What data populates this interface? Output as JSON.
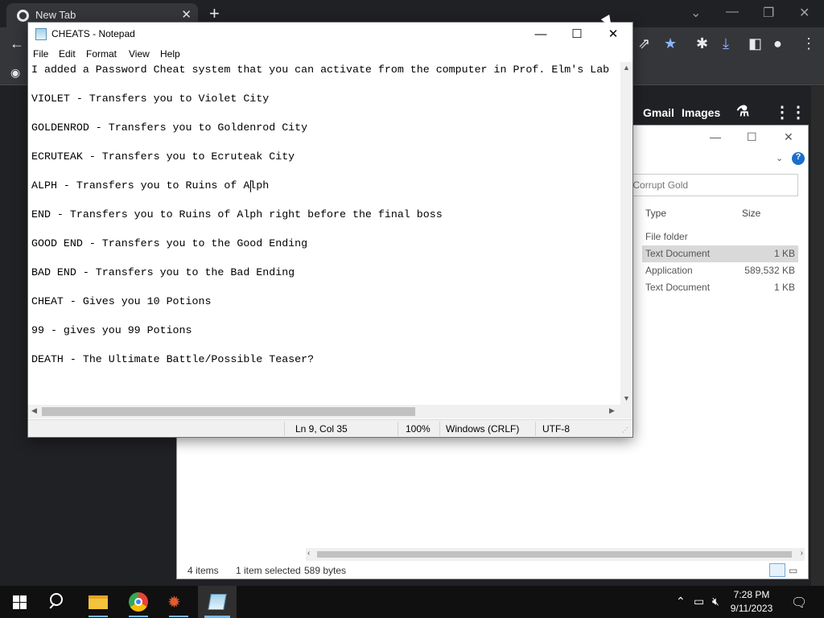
{
  "browser": {
    "tab_title": "New Tab",
    "google_links": {
      "gmail": "Gmail",
      "images": "Images"
    }
  },
  "explorer": {
    "search_placeholder": "Search Corrupt Gold",
    "columns": {
      "type": "Type",
      "size": "Size"
    },
    "rows": [
      {
        "type": "File folder",
        "size": ""
      },
      {
        "type": "Text Document",
        "size": "1 KB",
        "selected": true
      },
      {
        "type": "Application",
        "size": "589,532 KB"
      },
      {
        "type": "Text Document",
        "size": "1 KB"
      }
    ],
    "status": {
      "items": "4 items",
      "selected": "1 item selected",
      "bytes": "589 bytes"
    }
  },
  "notepad": {
    "title": "CHEATS - Notepad",
    "menu": {
      "file": "File",
      "edit": "Edit",
      "format": "Format",
      "view": "View",
      "help": "Help"
    },
    "lines": [
      "I added a Password Cheat system that you can activate from the computer in Prof. Elm's Lab",
      "",
      "VIOLET - Transfers you to Violet City",
      "",
      "GOLDENROD - Transfers you to Goldenrod City",
      "",
      "ECRUTEAK - Transfers you to Ecruteak City",
      "",
      "ALPH - Transfers you to Ruins of Alph",
      "",
      "END - Transfers you to Ruins of Alph right before the final boss",
      "",
      "GOOD END - Transfers you to the Good Ending",
      "",
      "BAD END - Transfers you to the Bad Ending",
      "",
      "CHEAT - Gives you 10 Potions",
      "",
      "99 - gives you 99 Potions",
      "",
      "DEATH - The Ultimate Battle/Possible Teaser?"
    ],
    "status": {
      "position": "Ln 9, Col 35",
      "zoom": "100%",
      "line_ending": "Windows (CRLF)",
      "encoding": "UTF-8"
    }
  },
  "taskbar": {
    "apps": [
      "start-icon",
      "search-icon",
      "file-explorer-icon",
      "chrome-icon",
      "game-icon",
      "notepad-icon"
    ],
    "time": "7:28 PM",
    "date": "9/11/2023"
  },
  "colors": {
    "taskbar": "#101010",
    "chrome_bg": "#202124",
    "chrome_toolbar": "#35363a",
    "bookmark_star": "#8ab4f8",
    "selected_row": "#d9d9d9"
  }
}
